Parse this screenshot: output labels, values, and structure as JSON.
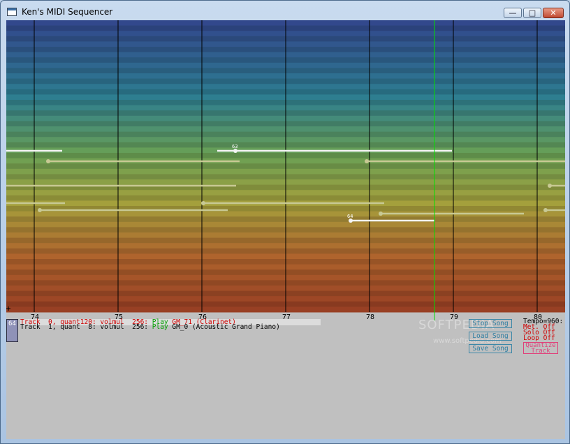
{
  "window": {
    "title": "Ken's MIDI Sequencer",
    "minimize_glyph": "—",
    "maximize_glyph": "□",
    "close_glyph": "✕"
  },
  "roll": {
    "measures": [
      {
        "label": "74"
      },
      {
        "label": "75"
      },
      {
        "label": "76"
      },
      {
        "label": "77"
      },
      {
        "label": "78"
      },
      {
        "label": "79"
      },
      {
        "label": "80"
      }
    ],
    "playhead_color": "#00e000",
    "note_labels": [
      "63",
      "64"
    ]
  },
  "keyboard": {
    "current_key": "64"
  },
  "tracks": [
    {
      "prefix": "Track  0, quant120: volmul  256: ",
      "play": "Play",
      "instrument": " GM_71 (Clarinet)"
    },
    {
      "prefix": "Track  1, quant  8: volmul  256: ",
      "play": "Play",
      "instrument": " GM_0 (Acoustic Grand Piano)"
    }
  ],
  "buttons": {
    "stop_song": "Stop Song",
    "load_song": "Load Song",
    "save_song": "Save Song",
    "quantize_track": "Quantize\nTrack"
  },
  "status": {
    "tempo": "Tempo=960:",
    "metronome": "Met. Off",
    "solo": "Solo Off",
    "loop": "Loop Off"
  },
  "watermark": {
    "brand": "SOFTPEDIA",
    "url": "www.softpedia.com"
  },
  "colors": {
    "red_text": "#d00000",
    "green_text": "#00a000",
    "button_blue": "#2f7fa3",
    "quantize_pink": "#e0407a"
  }
}
